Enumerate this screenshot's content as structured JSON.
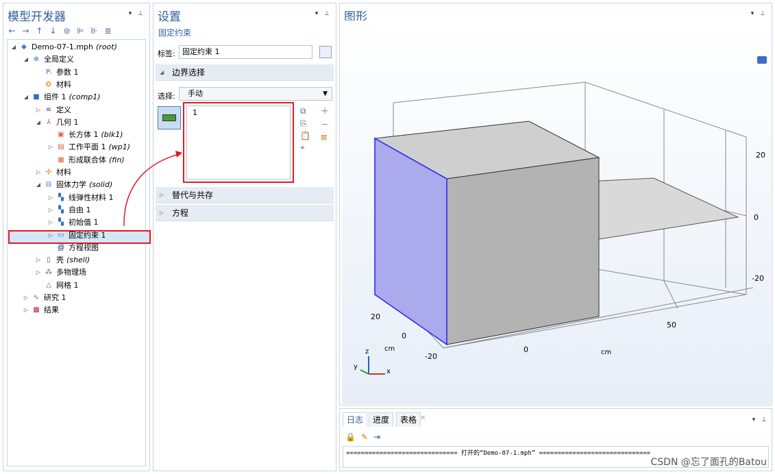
{
  "model_builder": {
    "title": "模型开发器",
    "toolbar": [
      "←",
      "→",
      "↑",
      "↓",
      "⊜",
      "⊫",
      "⊪",
      "≣"
    ],
    "tree": [
      {
        "label": "Demo-07-1.mph",
        "tag": "(root)",
        "icon": "◆",
        "color": "#3a7bd5"
      },
      {
        "label": "全局定义",
        "tag": "",
        "icon": "⊕",
        "color": "#2a6fc9"
      },
      {
        "label": "参数 1",
        "tag": "",
        "icon": "Pᵢ",
        "color": "#2a6fc9"
      },
      {
        "label": "材料",
        "tag": "",
        "icon": "❂",
        "color": "#e08a1e"
      },
      {
        "label": "组件 1",
        "tag": "(comp1)",
        "icon": "■",
        "color": "#2a6fc9"
      },
      {
        "label": "定义",
        "tag": "",
        "icon": "≡",
        "color": "#2a4f8a"
      },
      {
        "label": "几何 1",
        "tag": "",
        "icon": "⅄",
        "color": "#d84a3a"
      },
      {
        "label": "长方体 1",
        "tag": "(blk1)",
        "icon": "▣",
        "color": "#d8633a"
      },
      {
        "label": "工作平面 1",
        "tag": "(wp1)",
        "icon": "▤",
        "color": "#d8633a"
      },
      {
        "label": "形成联合体",
        "tag": "(fin)",
        "icon": "▦",
        "color": "#d8633a"
      },
      {
        "label": "材料",
        "tag": "",
        "icon": "✣",
        "color": "#e08a1e"
      },
      {
        "label": "固体力学",
        "tag": "(solid)",
        "icon": "⊟",
        "color": "#2a6fc9"
      },
      {
        "label": "线弹性材料 1",
        "tag": "",
        "icon": "▚",
        "color": "#2a6fc9"
      },
      {
        "label": "自由 1",
        "tag": "",
        "icon": "▚",
        "color": "#2a6fc9"
      },
      {
        "label": "初始值 1",
        "tag": "",
        "icon": "▚",
        "color": "#2a6fc9"
      },
      {
        "label": "固定约束 1",
        "tag": "",
        "icon": "▭",
        "color": "#2a6fc9"
      },
      {
        "label": "方程视图",
        "tag": "",
        "icon": "∰",
        "color": "#2a4f8a"
      },
      {
        "label": "壳",
        "tag": "(shell)",
        "icon": "▯",
        "color": "#555"
      },
      {
        "label": "多物理场",
        "tag": "",
        "icon": "⁂",
        "color": "#3a8a3a"
      },
      {
        "label": "网格 1",
        "tag": "",
        "icon": "△",
        "color": "#666"
      },
      {
        "label": "研究 1",
        "tag": "",
        "icon": "∿",
        "color": "#2a6fc9"
      },
      {
        "label": "结果",
        "tag": "",
        "icon": "▩",
        "color": "#b03050"
      }
    ]
  },
  "settings": {
    "title": "设置",
    "subtitle": "固定约束",
    "label_caption": "标签:",
    "label_value": "固定约束 1",
    "section_boundary": "边界选择",
    "selection_caption": "选择:",
    "selection_value": "手动",
    "list_items": [
      "1"
    ],
    "section_override": "替代与共存",
    "section_equation": "方程"
  },
  "graphics": {
    "title": "图形",
    "axis_labels": {
      "z_right": [
        "20",
        "0",
        "-20"
      ],
      "y_left": [
        "20",
        "0",
        "-20"
      ],
      "x_bottom": [
        "0",
        "50"
      ],
      "cm_left": "cm",
      "cm_bottom": "cm"
    },
    "triad": {
      "x": "x",
      "y": "y",
      "z": "z"
    }
  },
  "log": {
    "tabs": [
      "日志",
      "进度",
      "表格"
    ],
    "message": "============================== 打开的“Demo-07-1.mph” =============================="
  },
  "watermark": "CSDN @忘了面孔的Batou"
}
